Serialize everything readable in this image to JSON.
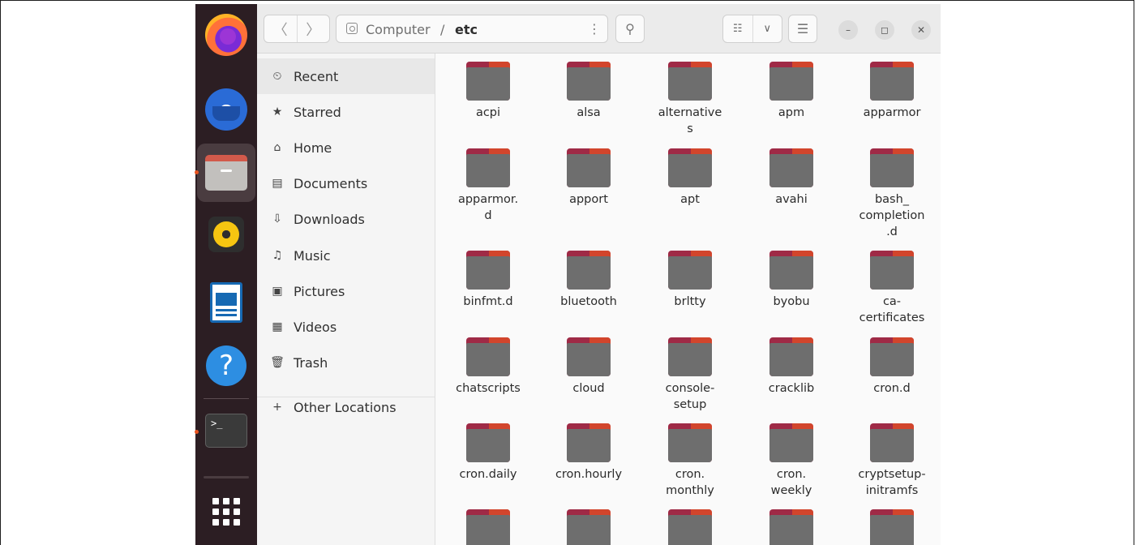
{
  "dock": {
    "items": [
      {
        "name": "Firefox",
        "icon": "firefox-icon"
      },
      {
        "name": "Thunderbird",
        "icon": "thunderbird-icon"
      },
      {
        "name": "Files",
        "icon": "files-icon",
        "active": true
      },
      {
        "name": "Rhythmbox",
        "icon": "rhythmbox-icon"
      },
      {
        "name": "LibreOffice Writer",
        "icon": "writer-icon"
      },
      {
        "name": "Help",
        "icon": "help-icon",
        "glyph": "?"
      },
      {
        "name": "Terminal",
        "icon": "terminal-icon",
        "glyph": ">_"
      },
      {
        "name": "Show Applications",
        "icon": "app-grid-icon"
      }
    ],
    "accent_color": "#e95420"
  },
  "toolbar": {
    "back_glyph": "〈",
    "forward_glyph": "〉",
    "path_location": "Computer",
    "path_separator": "/",
    "path_current": "etc",
    "path_menu_glyph": "⋮",
    "search_glyph": "⚲",
    "view_list_glyph": "☷",
    "view_dropdown_glyph": "∨",
    "menu_glyph": "☰",
    "minimize_glyph": "–",
    "maximize_glyph": "◻",
    "close_glyph": "✕"
  },
  "sidebar": {
    "items": [
      {
        "label": "Recent",
        "icon": "clock-icon",
        "glyph": "⏲"
      },
      {
        "label": "Starred",
        "icon": "star-icon",
        "glyph": "★"
      },
      {
        "label": "Home",
        "icon": "home-icon",
        "glyph": "⌂"
      },
      {
        "label": "Documents",
        "icon": "document-icon",
        "glyph": "▤"
      },
      {
        "label": "Downloads",
        "icon": "download-icon",
        "glyph": "⇩"
      },
      {
        "label": "Music",
        "icon": "music-icon",
        "glyph": "♫"
      },
      {
        "label": "Pictures",
        "icon": "pictures-icon",
        "glyph": "▣"
      },
      {
        "label": "Videos",
        "icon": "videos-icon",
        "glyph": "▦"
      },
      {
        "label": "Trash",
        "icon": "trash-icon",
        "glyph": "🗑"
      }
    ],
    "other_locations": {
      "label": "Other Locations",
      "glyph": "+"
    }
  },
  "folders": [
    "acpi",
    "alsa",
    "alternative\ns",
    "apm",
    "apparmor",
    "apparmor.\nd",
    "apport",
    "apt",
    "avahi",
    "bash_\ncompletion\n.d",
    "binfmt.d",
    "bluetooth",
    "brltty",
    "byobu",
    "ca-\ncertificates",
    "chatscripts",
    "cloud",
    "console-\nsetup",
    "cracklib",
    "cron.d",
    "cron.daily",
    "cron.hourly",
    "cron.\nmonthly",
    "cron.\nweekly",
    "cryptsetup-\ninitramfs",
    "",
    "",
    "",
    "",
    ""
  ],
  "colors": {
    "dock_bg": "#2c1e23",
    "folder_back": "#9f2a46",
    "folder_tab": "#d2452c",
    "folder_front": "#6e6e6e"
  }
}
